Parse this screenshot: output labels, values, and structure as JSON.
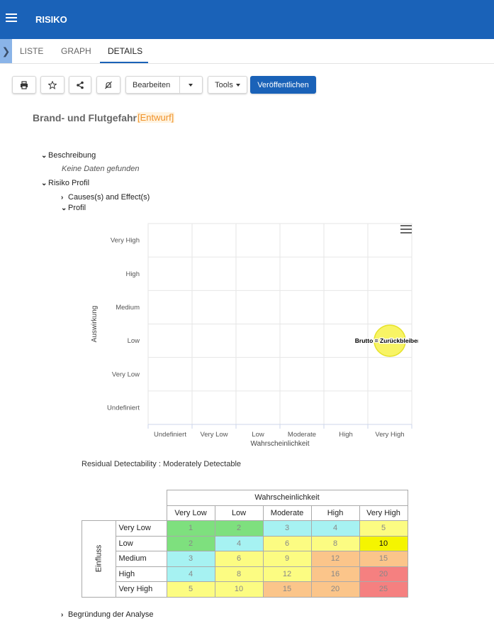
{
  "app": {
    "title": "RISIKO"
  },
  "tabs": [
    {
      "label": "LISTE"
    },
    {
      "label": "GRAPH"
    },
    {
      "label": "DETAILS"
    }
  ],
  "toolbar": {
    "edit_label": "Bearbeiten",
    "tools_label": "Tools",
    "publish_label": "Veröffentlichen"
  },
  "record": {
    "title": "Brand- und Flutgefahr",
    "status": "[Entwurf]"
  },
  "tree": {
    "beschreibung": "Beschreibung",
    "no_data": "Keine Daten gefunden",
    "risiko_profil": "Risiko Profil",
    "causes": "Causes(s) and Effect(s)",
    "profil": "Profil",
    "begruendung": "Begründung der Analyse"
  },
  "chart_data": {
    "type": "scatter",
    "xlabel": "Wahrscheinlichkeit",
    "ylabel": "Auswirkung",
    "x_categories": [
      "Undefiniert",
      "Very Low",
      "Low",
      "Moderate",
      "High",
      "Very High"
    ],
    "y_categories": [
      "Undefiniert",
      "Very Low",
      "Low",
      "Medium",
      "High",
      "Very High"
    ],
    "points": [
      {
        "x": "Very High",
        "y": "Low",
        "label": "Brutto = Zurückbleibend",
        "color": "#f5f032"
      }
    ],
    "grid": true
  },
  "detectability": "Residual Detectability : Moderately Detectable",
  "matrix": {
    "col_header": "Wahrscheinlichkeit",
    "row_header": "Einfluss",
    "cols": [
      "Very Low",
      "Low",
      "Moderate",
      "High",
      "Very High"
    ],
    "rows": [
      {
        "label": "Very Low",
        "values": [
          "1",
          "2",
          "3",
          "4",
          "5"
        ]
      },
      {
        "label": "Low",
        "values": [
          "2",
          "4",
          "6",
          "8",
          "10"
        ]
      },
      {
        "label": "Medium",
        "values": [
          "3",
          "6",
          "9",
          "12",
          "15"
        ]
      },
      {
        "label": "High",
        "values": [
          "4",
          "8",
          "12",
          "16",
          "20"
        ]
      },
      {
        "label": "Very High",
        "values": [
          "5",
          "10",
          "15",
          "20",
          "25"
        ]
      }
    ],
    "colors": {
      "green": "#7ee07e",
      "cyan": "#a6f2f2",
      "yellow": "#fcfc82",
      "orange": "#fbc58a",
      "red": "#f58080",
      "highlight": "#f5f500"
    }
  }
}
